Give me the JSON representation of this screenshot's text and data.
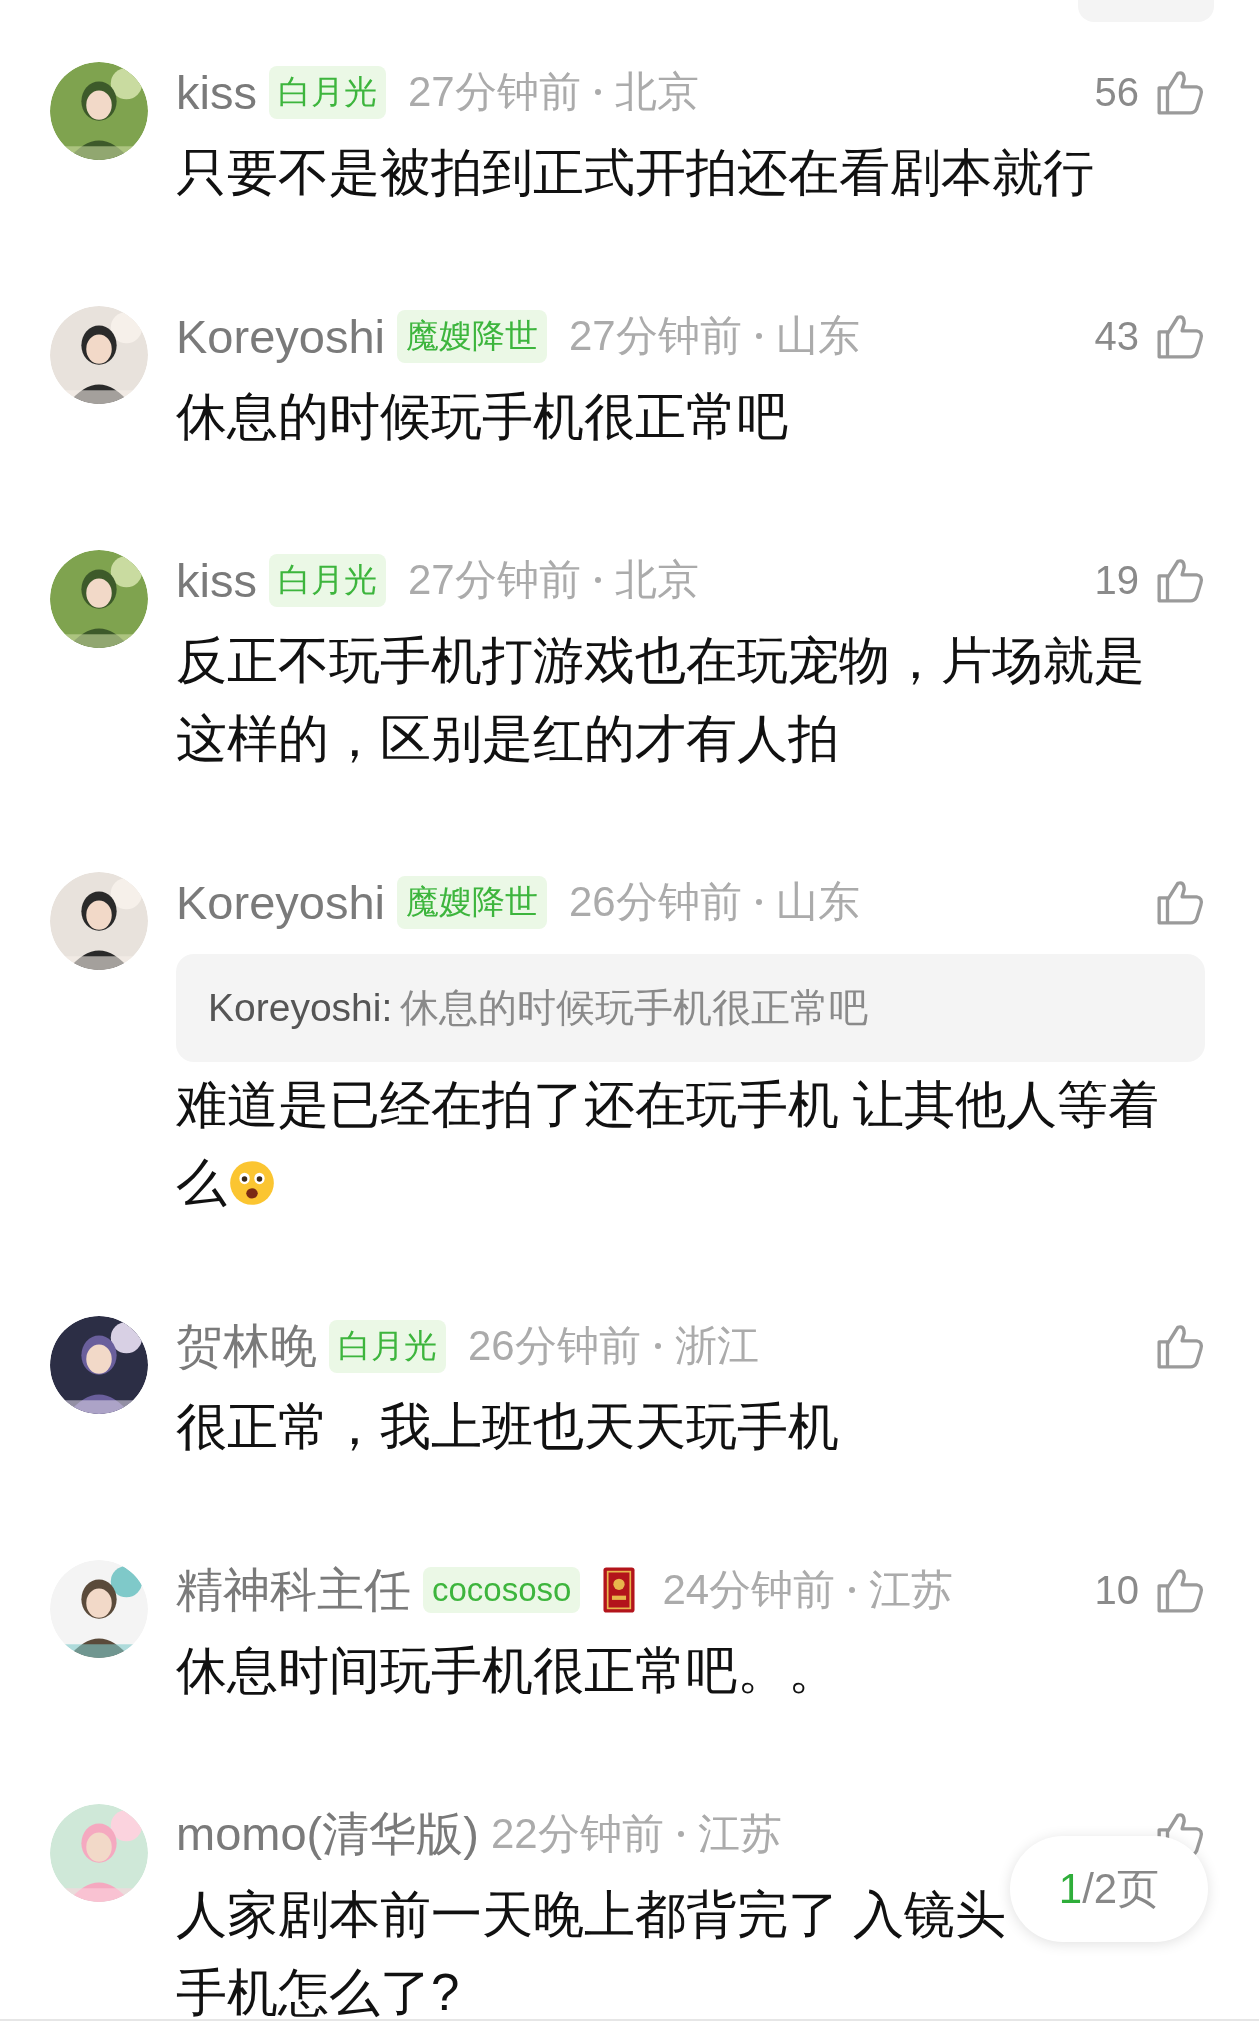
{
  "comments": [
    {
      "avatar": {
        "kind": "picture"
      },
      "name": "kiss",
      "badge": "白月光",
      "medal": false,
      "time": "27分钟前",
      "location": "北京",
      "likes": "56",
      "lines": [
        "只要不是被拍到正式开拍还在看剧本就行"
      ],
      "emoji": false
    },
    {
      "avatar": {
        "kind": "picture"
      },
      "name": "Koreyoshi",
      "badge": "魔嫂降世",
      "medal": false,
      "time": "27分钟前",
      "location": "山东",
      "likes": "43",
      "lines": [
        "休息的时候玩手机很正常吧"
      ],
      "emoji": false
    },
    {
      "avatar": {
        "kind": "picture"
      },
      "name": "kiss",
      "badge": "白月光",
      "medal": false,
      "time": "27分钟前",
      "location": "北京",
      "likes": "19",
      "lines": [
        "反正不玩手机打游戏也在玩宠物，片场就是",
        "这样的，区别是红的才有人拍"
      ],
      "emoji": false
    },
    {
      "avatar": {
        "kind": "picture"
      },
      "name": "Koreyoshi",
      "badge": "魔嫂降世",
      "medal": false,
      "time": "26分钟前",
      "location": "山东",
      "quote": {
        "author": "Koreyoshi:",
        "text": "休息的时候玩手机很正常吧"
      },
      "lines": [
        "难道是已经在拍了还在玩手机 让其他人等着",
        "么"
      ],
      "emoji": true
    },
    {
      "avatar": {
        "kind": "picture"
      },
      "name": "贺林晚",
      "badge": "白月光",
      "medal": false,
      "time": "26分钟前",
      "location": "浙江",
      "lines": [
        "很正常，我上班也天天玩手机"
      ],
      "emoji": false
    },
    {
      "avatar": {
        "kind": "picture"
      },
      "name": "精神科主任",
      "badge": "cocososo",
      "medal": true,
      "time": "24分钟前",
      "location": "江苏",
      "likes": "10",
      "lines": [
        "休息时间玩手机很正常吧。。"
      ],
      "emoji": false
    },
    {
      "avatar": {
        "kind": "picture"
      },
      "name": "momo(清华版)",
      "medal": false,
      "time": "22分钟前",
      "location": "江苏",
      "lines": [
        "人家剧本前一天晚上都背完了 入镜头",
        "手机怎么了?"
      ],
      "emoji": false
    }
  ],
  "pager": {
    "current": "1",
    "rest": "/2页"
  }
}
